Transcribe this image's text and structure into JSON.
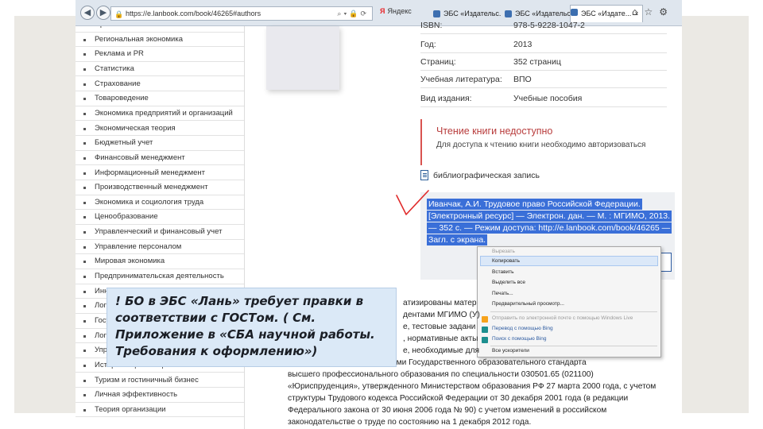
{
  "browser": {
    "url": "https://e.lanbook.com/book/46265#authors",
    "search_provider": "Яндекс",
    "search_provider_logo": "Я",
    "tabs": [
      {
        "label": "ЭБС «Издательс...",
        "active": false
      },
      {
        "label": "ЭБС «Издательс...",
        "active": false
      },
      {
        "label": "ЭБС «Издате...",
        "active": true
      }
    ],
    "tab_close": "×",
    "window_tools": "⌂☆⚙"
  },
  "sidebar": {
    "items": [
      "Право",
      "Региональная экономика",
      "Реклама и PR",
      "Статистика",
      "Страхование",
      "Товароведение",
      "Экономика предприятий и организаций",
      "Экономическая теория",
      "Бюджетный учет",
      "Финансовый менеджмент",
      "Информационный менеджмент",
      "Производственный менеджмент",
      "Экономика и социология труда",
      "Ценообразование",
      "Управленческий и финансовый учет",
      "Управление персоналом",
      "Мировая экономика",
      "Предпринимательская деятельность",
      "Инновационный менеджмент",
      "Логистика",
      "Государственное и муниципальное управление",
      "Логистика",
      "Управление качеством",
      "История и философия экономики",
      "Туризм и гостиничный бизнес",
      "Личная эффективность",
      "Теория организации"
    ]
  },
  "book": {
    "isbn_label": "ISBN:",
    "isbn_value": "978-5-9228-1047-2",
    "year_label": "Год:",
    "year_value": "2013",
    "pages_label": "Страниц:",
    "pages_value": "352 страниц",
    "lit_label": "Учебная литература:",
    "lit_value": "ВПО",
    "kind_label": "Вид издания:",
    "kind_value": "Учебные пособия"
  },
  "access": {
    "title": "Чтение книги недоступно",
    "text": "Для доступа к чтению книги необходимо авторизоваться"
  },
  "biblio_label": "библиографическая запись",
  "citation_lines": [
    "Иванчак, А.И. Трудовое право Российской Федерации.",
    "[Электронный ресурс] — Электрон. дан. — М. : МГИМО, 2013.",
    "— 352 с. — Режим доступа: http://e.lanbook.com/book/46265 —",
    "Загл. с экрана."
  ],
  "context_menu": {
    "items": [
      "Вырезать",
      "Копировать",
      "Вставить",
      "Выделить все",
      "Печать...",
      "Предварительный просмотр...",
      "Отправить по электронной почте с помощью Windows Live",
      "Перевод с помощью Bing",
      "Поиск с помощью Bing",
      "Все ускорители"
    ]
  },
  "body_lines": [
    "атизированы матер",
    "дентами МГИМО (У)",
    "е, тестовые задани",
    ", нормативные акты",
    "е, необходимые для",
    "с соответствии с требованиями Государственного образовательного стандарта",
    "высшего профессионального образования по специальности 030501.65 (021100)",
    "«Юриспруденция», утвержденного Министерством образования РФ 27 марта 2000 года, с учетом",
    "структуры Трудового кодекса Российской Федерации от 30 декабря 2001 года (в редакции",
    "Федерального закона от 30 июня 2006 года № 90) с учетом изменений в российском",
    "законодательстве о труде по состоянию на 1 декабря 2012 года."
  ],
  "note": {
    "text": "! БО  в ЭБС «Лань» требует правки в\nсоответствии с ГОСТом. ( См.\nПриложение в «СБА научной работы.\nТребования к оформлению»)"
  },
  "colors": {
    "selection": "#3a6fd8",
    "access_title": "#b83c3c",
    "note_bg": "#dbe9f7",
    "checkmark": "#e02a2a"
  }
}
